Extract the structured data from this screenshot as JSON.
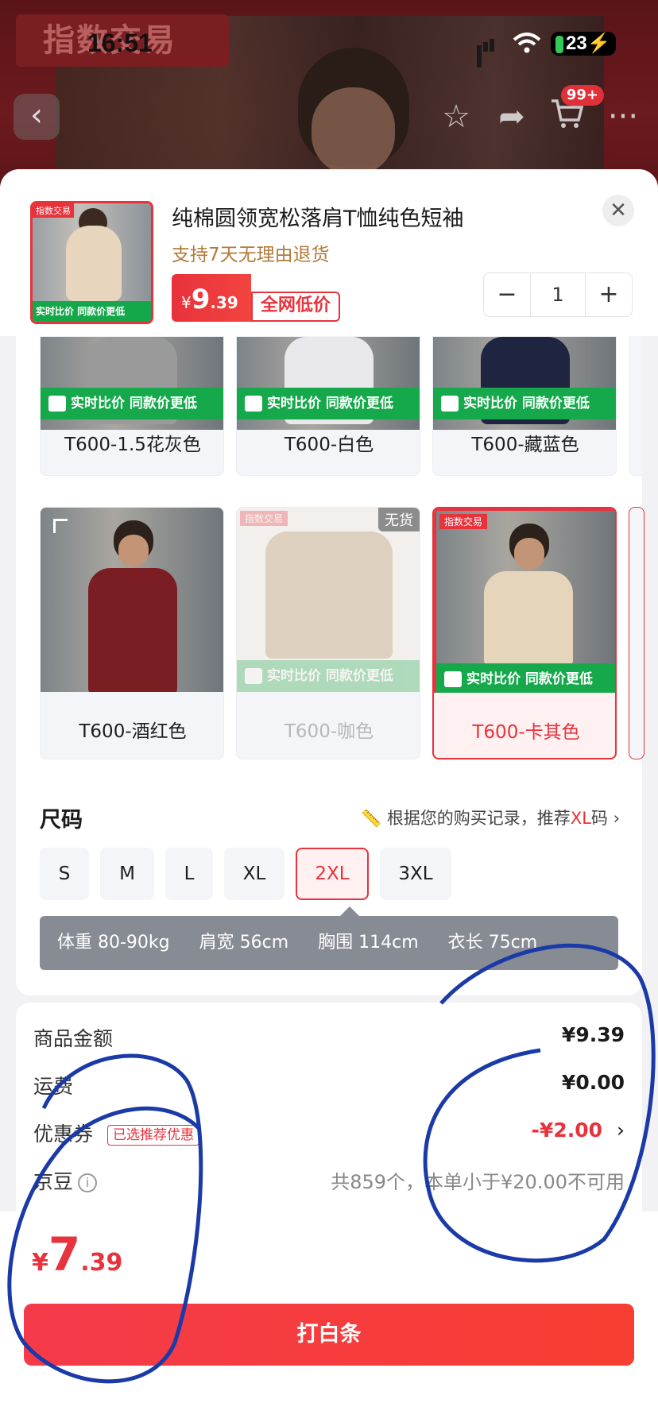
{
  "status": {
    "time": "16:51",
    "battery": "23"
  },
  "background": {
    "brand": "指数交易",
    "cart_badge": "99+"
  },
  "product": {
    "title": "纯棉圆领宽松落肩T恤纯色短袖",
    "return_policy": "支持7天无理由退货",
    "price_currency": "¥",
    "price_int": "9",
    "price_dec": ".39",
    "low_price_label": "全网低价",
    "thumb_tag": "指数交易",
    "thumb_strip": "实时比价 同款价更低",
    "quantity": "1"
  },
  "colors": [
    {
      "label": "T600-1.5花灰色",
      "shirt": "#9a9a9a",
      "state": "normal"
    },
    {
      "label": "T600-白色",
      "shirt": "#e9e9ec",
      "state": "normal"
    },
    {
      "label": "T600-藏蓝色",
      "shirt": "#1f2440",
      "state": "normal"
    },
    {
      "label": "T600-酒红色",
      "shirt": "#7b1e24",
      "state": "normal"
    },
    {
      "label": "T600-咖色",
      "shirt": "#d8c8b2",
      "state": "out_of_stock",
      "badge": "无货"
    },
    {
      "label": "T600-卡其色",
      "shirt": "#e5d5bb",
      "state": "selected"
    }
  ],
  "green_strip": "实时比价 同款价更低",
  "red_tag": "指数交易",
  "size": {
    "title": "尺码",
    "hint_prefix": "根据您的购买记录，推荐",
    "hint_size": "XL",
    "hint_suffix": "码",
    "options": [
      "S",
      "M",
      "L",
      "XL",
      "2XL",
      "3XL"
    ],
    "selected": "2XL",
    "measures": [
      "体重 80-90kg",
      "肩宽 56cm",
      "胸围 114cm",
      "衣长 75cm"
    ]
  },
  "summary": {
    "goods_label": "商品金额",
    "goods_value": "¥9.39",
    "shipping_label": "运费",
    "shipping_value": "¥0.00",
    "coupon_label": "优惠券",
    "coupon_chip": "已选推荐优惠",
    "coupon_value": "-¥2.00",
    "beans_label": "京豆",
    "beans_value": "共859个，本单小于¥20.00不可用"
  },
  "total": {
    "currency": "¥",
    "int": "7",
    "dec": ".39"
  },
  "pay_button": "打白条",
  "colors_theme": {
    "accent": "#e8323c",
    "green": "#16a94c",
    "annotation": "#1a3aa8"
  }
}
